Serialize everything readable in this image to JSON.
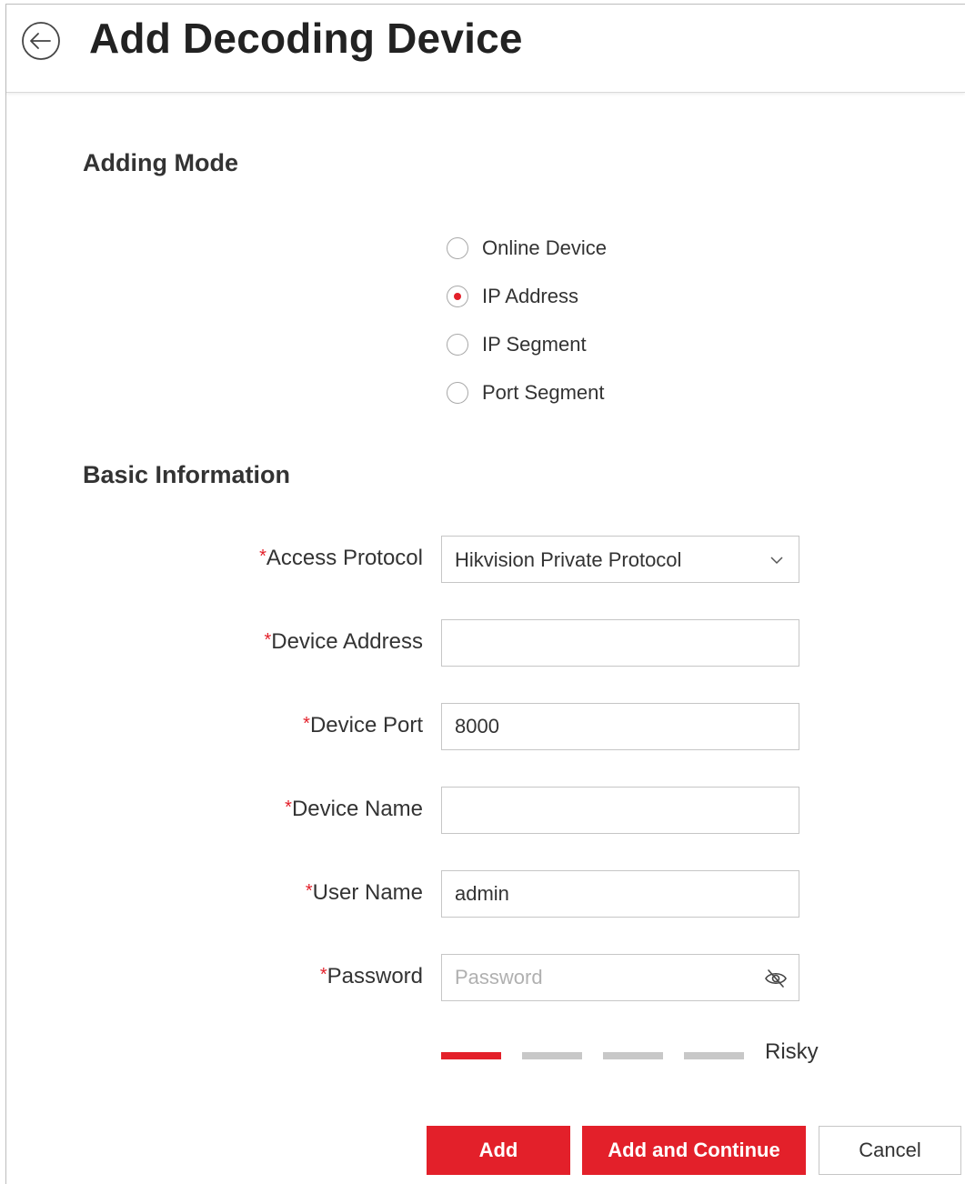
{
  "header": {
    "title": "Add Decoding Device"
  },
  "adding_mode": {
    "heading": "Adding Mode",
    "options": [
      {
        "label": "Online Device",
        "checked": false
      },
      {
        "label": "IP Address",
        "checked": true
      },
      {
        "label": "IP Segment",
        "checked": false
      },
      {
        "label": "Port Segment",
        "checked": false
      }
    ]
  },
  "basic_info": {
    "heading": "Basic Information",
    "required_mark": "*",
    "access_protocol": {
      "label": "Access Protocol",
      "value": "Hikvision Private Protocol"
    },
    "device_address": {
      "label": "Device Address",
      "value": ""
    },
    "device_port": {
      "label": "Device Port",
      "value": "8000"
    },
    "device_name": {
      "label": "Device Name",
      "value": ""
    },
    "user_name": {
      "label": "User Name",
      "value": "admin"
    },
    "password": {
      "label": "Password",
      "value": "",
      "placeholder": "Password"
    }
  },
  "password_strength": {
    "label": "Risky",
    "level": 1,
    "total_levels": 4,
    "active_color": "#e3202a",
    "inactive_color": "#c8c8c8"
  },
  "buttons": {
    "add": "Add",
    "add_continue": "Add and Continue",
    "cancel": "Cancel"
  },
  "colors": {
    "accent": "#e3202a"
  }
}
